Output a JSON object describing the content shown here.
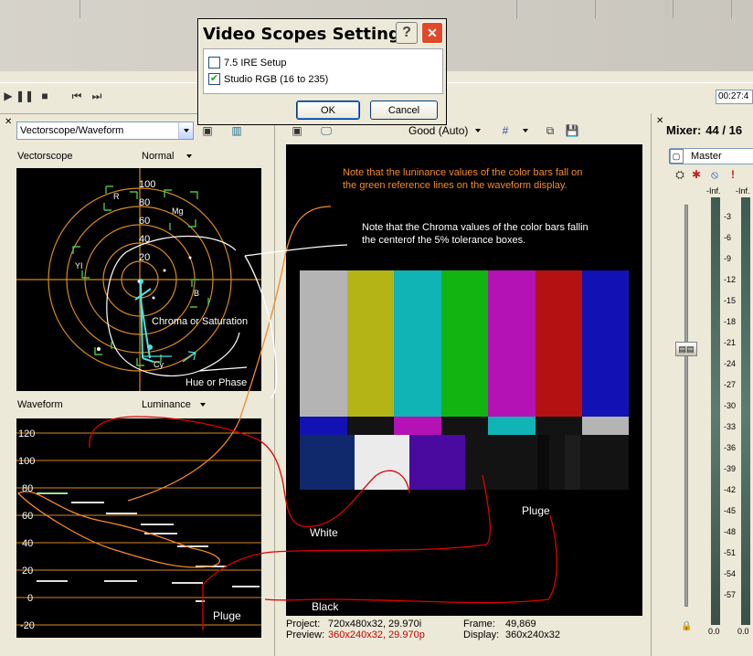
{
  "dialog": {
    "title": "Video Scopes Settings",
    "help_glyph": "?",
    "close_glyph": "✕",
    "options": [
      {
        "label": "7.5 IRE Setup",
        "checked": false,
        "mark": ""
      },
      {
        "label": "Studio RGB (16 to 235)",
        "checked": true,
        "mark": "✔"
      }
    ],
    "ok_label": "OK",
    "cancel_label": "Cancel"
  },
  "transport": {
    "timecode": "00:27:4"
  },
  "scopes": {
    "mode_select": "Vectorscope/Waveform",
    "vectorscope_label": "Vectorscope",
    "vectorscope_mode": "Normal",
    "vector_rings": [
      "100",
      "80",
      "60",
      "40",
      "20"
    ],
    "vector_targets": [
      "R",
      "Mg",
      "YI",
      "B",
      "Cy"
    ],
    "waveform_label": "Waveform",
    "waveform_mode": "Luminance",
    "waveform_ticks": [
      "120",
      "100",
      "80",
      "60",
      "40",
      "20",
      "0",
      "-20"
    ]
  },
  "preview": {
    "quality": "Good (Auto)",
    "note_luminance": "Note that the luninance values of the color bars fall on the green reference lines on the waveform display.",
    "note_chroma": "Note that the Chroma values of the color bars fallin the centerof the 5% tolerance boxes.",
    "project_label": "Project:",
    "project_value": "720x480x32, 29.970i",
    "preview_label": "Preview:",
    "preview_value": "360x240x32, 29.970p",
    "frame_label": "Frame:",
    "frame_value": "49,869",
    "display_label": "Display:",
    "display_value": "360x240x32"
  },
  "annotations": {
    "chroma": "Chroma or Saturation",
    "hue": "Hue or Phase",
    "white": "White",
    "pluge_right": "Pluge",
    "pluge_left": "Pluge",
    "black": "Black"
  },
  "mixer": {
    "title": "Mixer:",
    "count": "44 / 16",
    "master_label": "Master",
    "peak_left": "-Inf.",
    "peak_right": "-Inf.",
    "db_scale": [
      "3",
      "6",
      "9",
      "12",
      "15",
      "18",
      "21",
      "24",
      "27",
      "30",
      "33",
      "36",
      "39",
      "42",
      "45",
      "48",
      "51",
      "54",
      "57"
    ],
    "level_left": "0.0",
    "level_right": "0.0"
  },
  "colors": {
    "note_orange": "#f08a2c",
    "annotation_red": "#e00000",
    "annotation_white": "#ffffff",
    "graticule_orange": "#d88a1e",
    "trace_cyan": "#4fe0e0",
    "target_green": "#4cc04c",
    "red_value": "#c00000"
  }
}
